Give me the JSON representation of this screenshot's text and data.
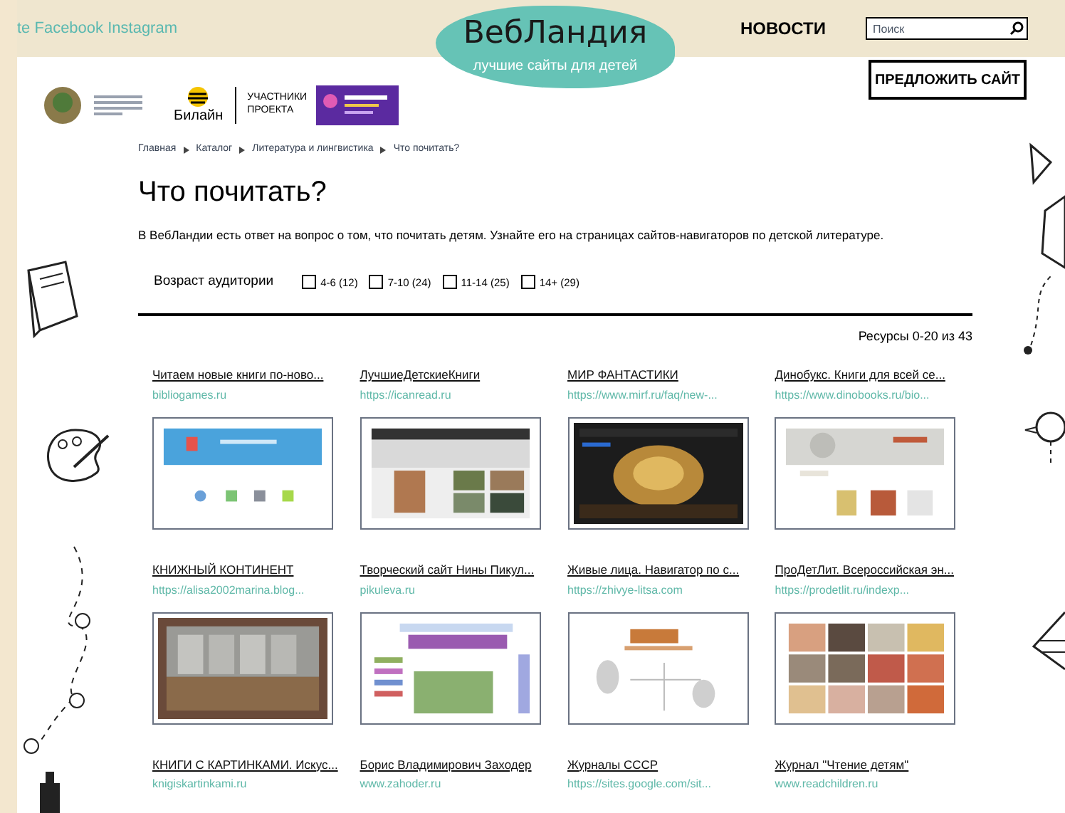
{
  "top_bar": {
    "social_links": "te Facebook Instagram",
    "nav_link": "НОВОСТИ",
    "search": {
      "placeholder": "Поиск"
    }
  },
  "logo": {
    "title": "ВебЛандия",
    "subtitle": "лучшие сайты для детей"
  },
  "suggest_button": "ПРЕДЛОЖИТЬ САЙТ",
  "partners": {
    "beeline": "Билайн",
    "participants": "УЧАСТНИКИ ПРОЕКТА"
  },
  "breadcrumbs": [
    "Главная",
    "Каталог",
    "Литература и лингвистика",
    "Что почитать?"
  ],
  "title": "Что почитать?",
  "intro": "В ВебЛандии есть ответ на вопрос о том, что почитать детям. Узнайте его на страницах сайтов-навигаторов по детской литературе.",
  "filter": {
    "label": "Возраст аудитории",
    "options": [
      {
        "label": "4-6 (12)",
        "checked": false
      },
      {
        "label": "7-10 (24)",
        "checked": false
      },
      {
        "label": "11-14 (25)",
        "checked": false
      },
      {
        "label": "14+ (29)",
        "checked": false
      }
    ]
  },
  "results_count": "Ресурсы 0-20 из 43",
  "sites": [
    {
      "title": "Читаем новые книги по-ново...",
      "url": "bibliogames.ru",
      "kind": "picture"
    },
    {
      "title": "ЛучшиеДетскиеКниги",
      "url": "https://icanread.ru",
      "kind": "picture"
    },
    {
      "title": "МИР ФАНТАСТИКИ",
      "url": "https://www.mirf.ru/faq/new-...",
      "kind": "picture"
    },
    {
      "title": "Динобукс. Книги для всей се...",
      "url": "https://www.dinobooks.ru/bio...",
      "kind": "picture"
    },
    {
      "title": "КНИЖНЫЙ КОНТИНЕНТ",
      "url": "https://alisa2002marina.blog...",
      "kind": "picture"
    },
    {
      "title": "Творческий сайт Нины Пикул...",
      "url": "pikuleva.ru",
      "kind": "picture"
    },
    {
      "title": "Живые лица. Навигатор по с...",
      "url": "https://zhivye-litsa.com",
      "kind": "picture"
    },
    {
      "title": "ПроДетЛит. Всероссийская эн...",
      "url": "https://prodetlit.ru/indexp...",
      "kind": "picture"
    },
    {
      "title": "КНИГИ С КАРТИНКАМИ. Искус...",
      "url": "knigiskartinkami.ru"
    },
    {
      "title": "Борис Владимирович Заходер",
      "url": "www.zahoder.ru"
    },
    {
      "title": "Журналы СССР",
      "url": "https://sites.google.com/sit..."
    },
    {
      "title": "Журнал \"Чтение детям\"",
      "url": "www.readchildren.ru"
    }
  ]
}
